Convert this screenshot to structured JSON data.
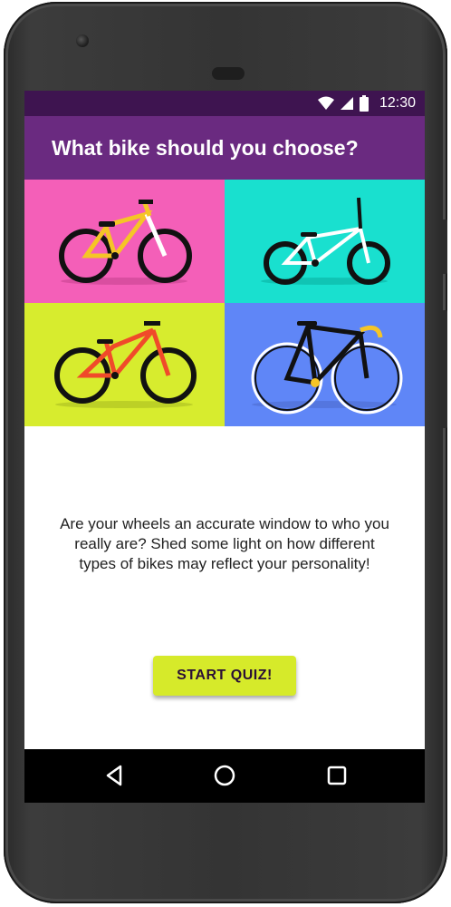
{
  "status": {
    "time": "12:30"
  },
  "app": {
    "title": "What bike should you choose?"
  },
  "tiles": {
    "colors": [
      "#f45fb8",
      "#19e0cf",
      "#d7ec2e",
      "#5f86f7"
    ]
  },
  "main": {
    "description": "Are your wheels an accurate window to who you really are? Shed some light on how different types of bikes may reflect your personality!",
    "start_label": "START QUIZ!"
  },
  "icons": {
    "wifi": "wifi-icon",
    "signal": "signal-icon",
    "battery": "battery-icon",
    "back": "back-triangle-icon",
    "home": "home-circle-icon",
    "recents": "recents-square-icon"
  }
}
